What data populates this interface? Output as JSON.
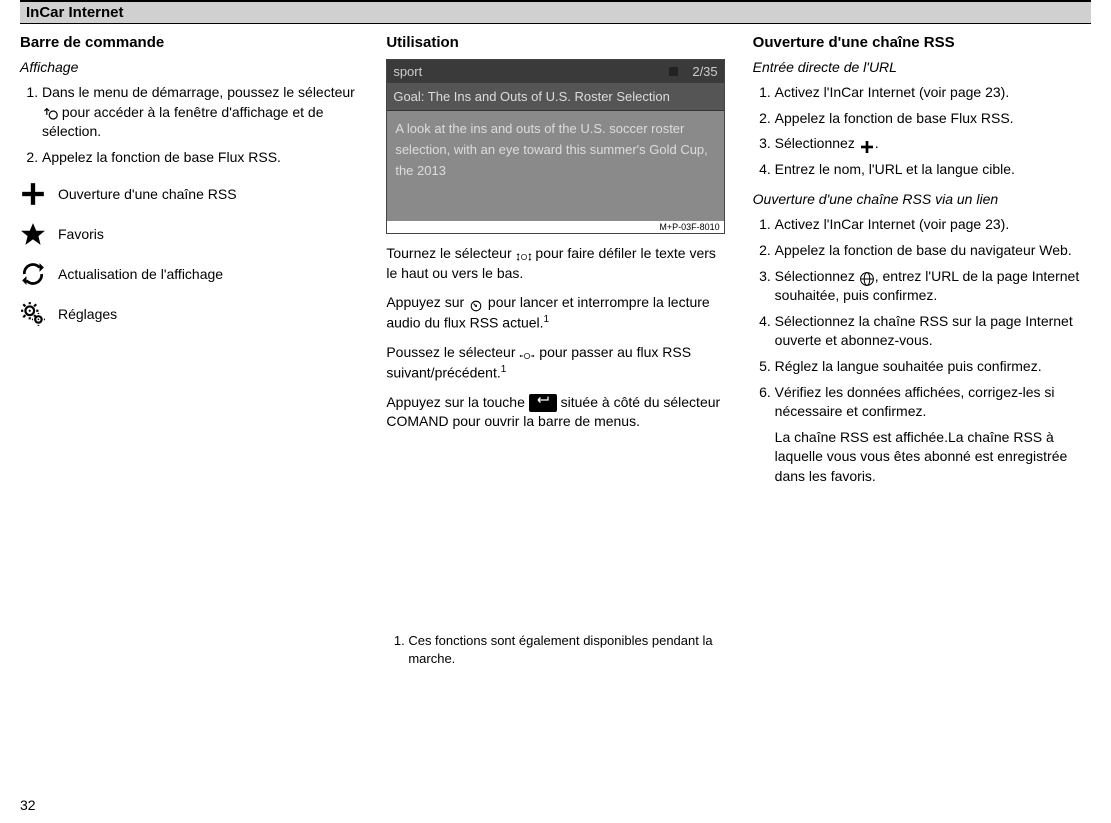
{
  "header": {
    "title": "InCar Internet"
  },
  "col1": {
    "heading": "Barre de commande",
    "sub": "Affichage",
    "step1a": "Dans le menu de démarrage, poussez le sélecteur ",
    "step1b": " pour accéder à la fenêtre d'affichage et de sélection.",
    "step2": "Appelez la fonction de base Flux RSS.",
    "items": {
      "rss": "Ouverture d'une chaîne RSS",
      "fav": "Favoris",
      "refresh": "Actualisation de l'affichage",
      "settings": "Réglages"
    }
  },
  "col2": {
    "heading": "Utilisation",
    "screenshot": {
      "topLeft": "sport",
      "topRight": "2/35",
      "title": "Goal: The Ins and Outs of U.S. Roster Selection",
      "body": "A look at the ins and outs of the U.S. soccer roster selection, with an eye toward this summer's Gold Cup, the 2013",
      "ref": "M+P-03F-8010"
    },
    "p1a": "Tournez le sélecteur ",
    "p1b": " pour faire défiler le texte vers le haut ou vers le bas.",
    "p2a": "Appuyez sur ",
    "p2b": " pour lancer et interrompre la lecture audio du flux RSS actuel.",
    "p3a": "Poussez le sélecteur ",
    "p3b": " pour passer au flux RSS suivant/précédent.",
    "p4a": "Appuyez sur la touche ",
    "p4b": " située à côté du sélecteur COMAND pour ouvrir la barre de menus.",
    "backKey": "↩",
    "footnote": "Ces fonctions sont également disponibles pendant la marche."
  },
  "col3": {
    "heading": "Ouverture d'une chaîne RSS",
    "sub1": "Entrée directe de l'URL",
    "a1": "Activez l'InCar Internet (voir page 23).",
    "a2": "Appelez la fonction de base Flux RSS.",
    "a3a": "Sélectionnez ",
    "a3b": ".",
    "a4": "Entrez le nom, l'URL et la langue cible.",
    "sub2": "Ouverture d'une chaîne RSS via un lien",
    "b1": "Activez l'InCar Internet (voir page 23).",
    "b2": "Appelez la fonction de base du navigateur Web.",
    "b3a": "Sélectionnez ",
    "b3b": ", entrez l'URL de la page Internet souhaitée, puis confirmez.",
    "b4": "Sélectionnez la chaîne RSS sur la page Internet ouverte et abonnez-vous.",
    "b5": "Réglez la langue souhaitée puis confirmez.",
    "b6": "Vérifiez les données affichées, corrigez-les si nécessaire et confirmez.",
    "b7": "La chaîne RSS est affichée.La chaîne RSS à laquelle vous vous êtes abonné est enregistrée dans les favoris."
  },
  "pageNumber": "32"
}
